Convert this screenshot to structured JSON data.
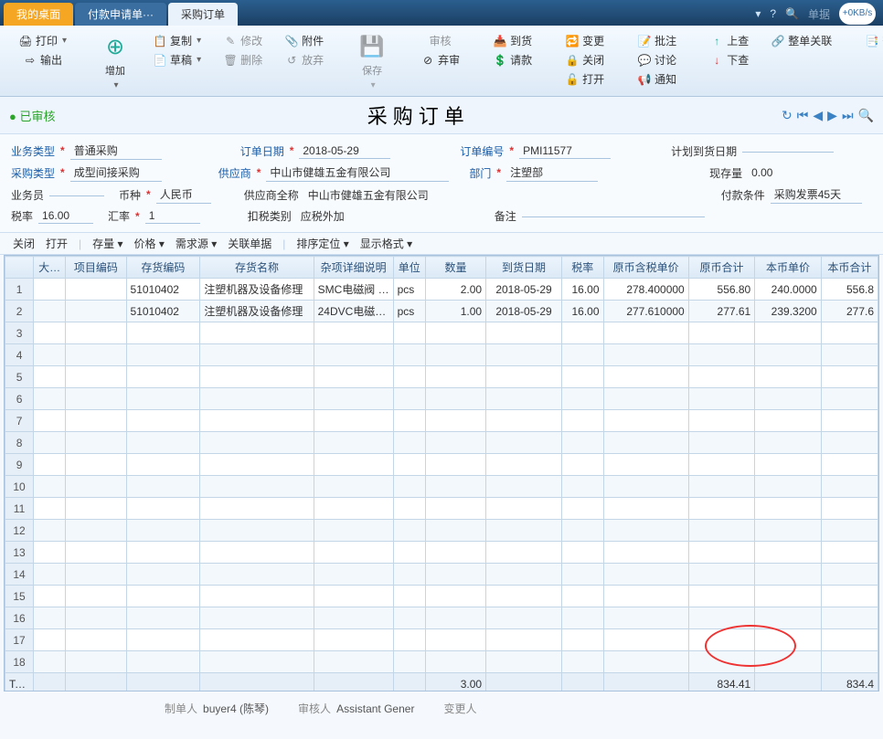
{
  "tabs": {
    "desktop": "我的桌面",
    "payment": "付款申请单···",
    "purchase": "采购订单"
  },
  "topright": {
    "speed": "+0KB/s",
    "search_placeholder": "单据"
  },
  "ribbon": {
    "print": "打印",
    "output": "输出",
    "add": "增加",
    "copy": "复制",
    "draft": "草稿",
    "modify": "修改",
    "delete": "删除",
    "attachment": "附件",
    "drop": "放弃",
    "save": "保存",
    "audit": "审核",
    "abandon": "弃审",
    "arrival": "到货",
    "request_pay": "请款",
    "change": "变更",
    "close": "关闭",
    "open": "打开",
    "approve_note": "批注",
    "discuss": "讨论",
    "notify": "通知",
    "query_up": "上查",
    "query_down": "下查",
    "whole_relate": "整单关联",
    "view_log": "查看日志"
  },
  "status": "● 已审核",
  "title": "采购订单",
  "form": {
    "labels": {
      "biz_type": "业务类型",
      "purchase_type": "采购类型",
      "buyer": "业务员",
      "tax_rate": "税率",
      "currency": "币种",
      "exchange_rate": "汇率",
      "order_date": "订单日期",
      "supplier": "供应商",
      "supplier_full": "供应商全称",
      "deduct_type": "扣税类别",
      "order_no": "订单编号",
      "dept": "部门",
      "remark": "备注",
      "plan_arrive": "计划到货日期",
      "stock": "现存量",
      "pay_term": "付款条件"
    },
    "values": {
      "biz_type": "普通采购",
      "purchase_type": "成型间接采购",
      "buyer": "",
      "tax_rate": "16.00",
      "currency": "人民币",
      "exchange_rate": "1",
      "order_date": "2018-05-29",
      "supplier": "中山市健雄五金有限公司",
      "supplier_full": "中山市健雄五金有限公司",
      "deduct_type": "应税外加",
      "order_no": "PMI11577",
      "dept": "注塑部",
      "remark": "",
      "plan_arrive": "",
      "stock": "0.00",
      "pay_term": "采购发票45天"
    }
  },
  "subtoolbar": {
    "close": "关闭",
    "open": "打开",
    "stock": "存量",
    "price": "价格",
    "demand": "需求源",
    "relation": "关联单据",
    "sort": "排序定位",
    "display": "显示格式"
  },
  "grid": {
    "headers": {
      "rownum": "",
      "big": "大…",
      "project_code": "项目编码",
      "inv_code": "存货编码",
      "inv_name": "存货名称",
      "misc_detail": "杂项详细说明",
      "unit": "单位",
      "qty": "数量",
      "arrive_date": "到货日期",
      "tax_rate": "税率",
      "orig_tax_price": "原币含税单价",
      "orig_sum": "原币合计",
      "local_price": "本币单价",
      "local_sum": "本币合计"
    },
    "rows": [
      {
        "n": "1",
        "inv_code": "51010402",
        "inv_name": "注塑机器及设备修理",
        "misc": "SMC电磁阀 …",
        "unit": "pcs",
        "qty": "2.00",
        "date": "2018-05-29",
        "tax": "16.00",
        "otp": "278.400000",
        "osum": "556.80",
        "lp": "240.0000",
        "lsum": "556.8"
      },
      {
        "n": "2",
        "inv_code": "51010402",
        "inv_name": "注塑机器及设备修理",
        "misc": "24DVC电磁…",
        "unit": "pcs",
        "qty": "1.00",
        "date": "2018-05-29",
        "tax": "16.00",
        "otp": "277.610000",
        "osum": "277.61",
        "lp": "239.3200",
        "lsum": "277.6"
      }
    ],
    "empty_rows": [
      "3",
      "4",
      "5",
      "6",
      "7",
      "8",
      "9",
      "10",
      "11",
      "12",
      "13",
      "14",
      "15",
      "16",
      "17",
      "18"
    ],
    "total": {
      "label": "Total",
      "qty": "3.00",
      "osum": "834.41",
      "lsum": "834.4"
    }
  },
  "footer": {
    "creator_label": "制单人",
    "creator": "buyer4 (陈琴)",
    "auditor_label": "审核人",
    "auditor": "Assistant Gener",
    "changer_label": "变更人",
    "changer": ""
  }
}
